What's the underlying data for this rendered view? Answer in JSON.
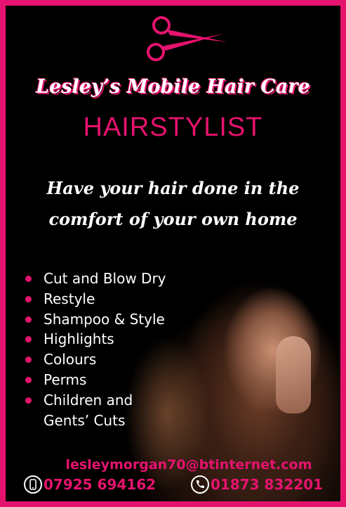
{
  "brand": {
    "title": "Lesley’s Mobile Hair Care",
    "subtitle": "HAIRSTYLIST",
    "logo_icon": "scissors-icon",
    "accent_color": "#e6136e"
  },
  "tagline": {
    "line1": "Have your hair done in the",
    "line2": "comfort of your own home"
  },
  "services": [
    "Cut and Blow Dry",
    "Restyle",
    "Shampoo & Style",
    "Highlights",
    "Colours",
    "Perms",
    "Children and",
    "Gents’ Cuts"
  ],
  "contact": {
    "email": "lesleymorgan70@btinternet.com",
    "mobile_icon": "mobile-phone-icon",
    "mobile": "07925 694162",
    "landline_icon": "telephone-icon",
    "landline": "01873 832201"
  }
}
